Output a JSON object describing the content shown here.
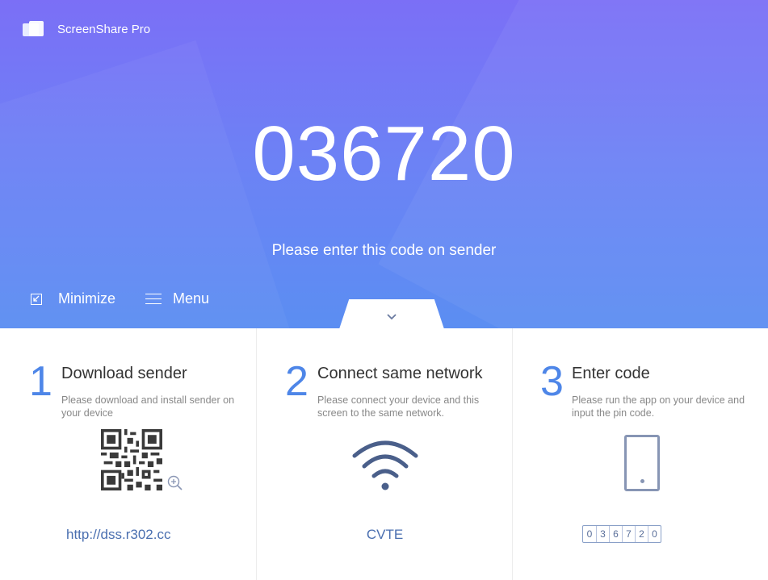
{
  "app": {
    "title": "ScreenShare Pro",
    "logo_icon": "screenshare-logo-icon"
  },
  "pairing": {
    "code": "036720",
    "instruction": "Please enter this code on sender"
  },
  "controls": {
    "minimize": {
      "label": "Minimize",
      "icon": "minimize-icon"
    },
    "menu": {
      "label": "Menu",
      "icon": "menu-icon"
    },
    "expand_tab_icon": "chevron-down-icon"
  },
  "steps": [
    {
      "number": "1",
      "title": "Download sender",
      "description": "Please download and install sender on your device",
      "link": "http://dss.r302.cc",
      "icons": [
        "qr-code-icon",
        "zoom-in-icon"
      ]
    },
    {
      "number": "2",
      "title": "Connect same network",
      "description": "Please connect your device and this screen to the same network.",
      "network": "CVTE",
      "icons": [
        "wifi-icon"
      ]
    },
    {
      "number": "3",
      "title": "Enter code",
      "description": "Please run the app on your device and input the pin code.",
      "code_digits": [
        "0",
        "3",
        "6",
        "7",
        "2",
        "0"
      ],
      "icons": [
        "device-icon"
      ]
    }
  ],
  "colors": {
    "accent": "#4e86e8",
    "gradient_top": "#7b6ff6",
    "gradient_bottom": "#5b8ef2",
    "link": "#4a6fb0"
  }
}
